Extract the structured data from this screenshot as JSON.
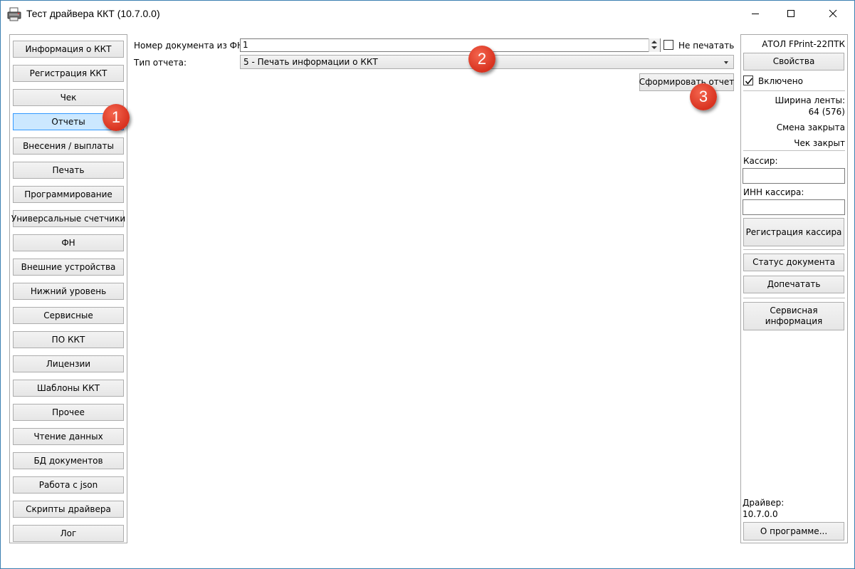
{
  "window": {
    "title": "Тест драйвера ККТ (10.7.0.0)",
    "accent_color": "#3c7fb1"
  },
  "nav": {
    "items": [
      {
        "label": "Информация о ККТ"
      },
      {
        "label": "Регистрация ККТ"
      },
      {
        "label": "Чек"
      },
      {
        "label": "Отчеты",
        "selected": true
      },
      {
        "label": "Внесения / выплаты"
      },
      {
        "label": "Печать"
      },
      {
        "label": "Программирование"
      },
      {
        "label": "Универсальные счетчики"
      },
      {
        "label": "ФН"
      },
      {
        "label": "Внешние устройства"
      },
      {
        "label": "Нижний уровень"
      },
      {
        "label": "Сервисные"
      },
      {
        "label": "ПО ККТ"
      },
      {
        "label": "Лицензии"
      },
      {
        "label": "Шаблоны ККТ"
      },
      {
        "label": "Прочее"
      },
      {
        "label": "Чтение данных"
      },
      {
        "label": "БД документов"
      },
      {
        "label": "Работа с json"
      },
      {
        "label": "Скрипты драйвера"
      },
      {
        "label": "Лог"
      }
    ]
  },
  "main": {
    "doc_number_label": "Номер документа из ФН:",
    "doc_number_value": "1",
    "no_print_label": "Не печатать",
    "no_print_checked": false,
    "report_type_label": "Тип отчета:",
    "report_type_value": "5 - Печать информации о ККТ",
    "generate_button": "Сформировать отчет"
  },
  "badges": [
    "1",
    "2",
    "3"
  ],
  "badge_color": "#d8321f",
  "right": {
    "device_name": "АТОЛ FPrint-22ПТК",
    "properties_button": "Свойства",
    "enabled_label": "Включено",
    "enabled_checked": true,
    "tape_width_label": "Ширина ленты:",
    "tape_width_value": "64 (576)",
    "shift_status": "Смена закрыта",
    "receipt_status": "Чек закрыт",
    "cashier_label": "Кассир:",
    "cashier_value": "",
    "cashier_inn_label": "ИНН кассира:",
    "cashier_inn_value": "",
    "register_cashier_button": "Регистрация кассира",
    "doc_status_button": "Статус документа",
    "reprint_button": "Допечатать",
    "service_info_button": "Сервисная информация",
    "driver_label": "Драйвер:",
    "driver_version": "10.7.0.0",
    "about_button": "О программе..."
  }
}
